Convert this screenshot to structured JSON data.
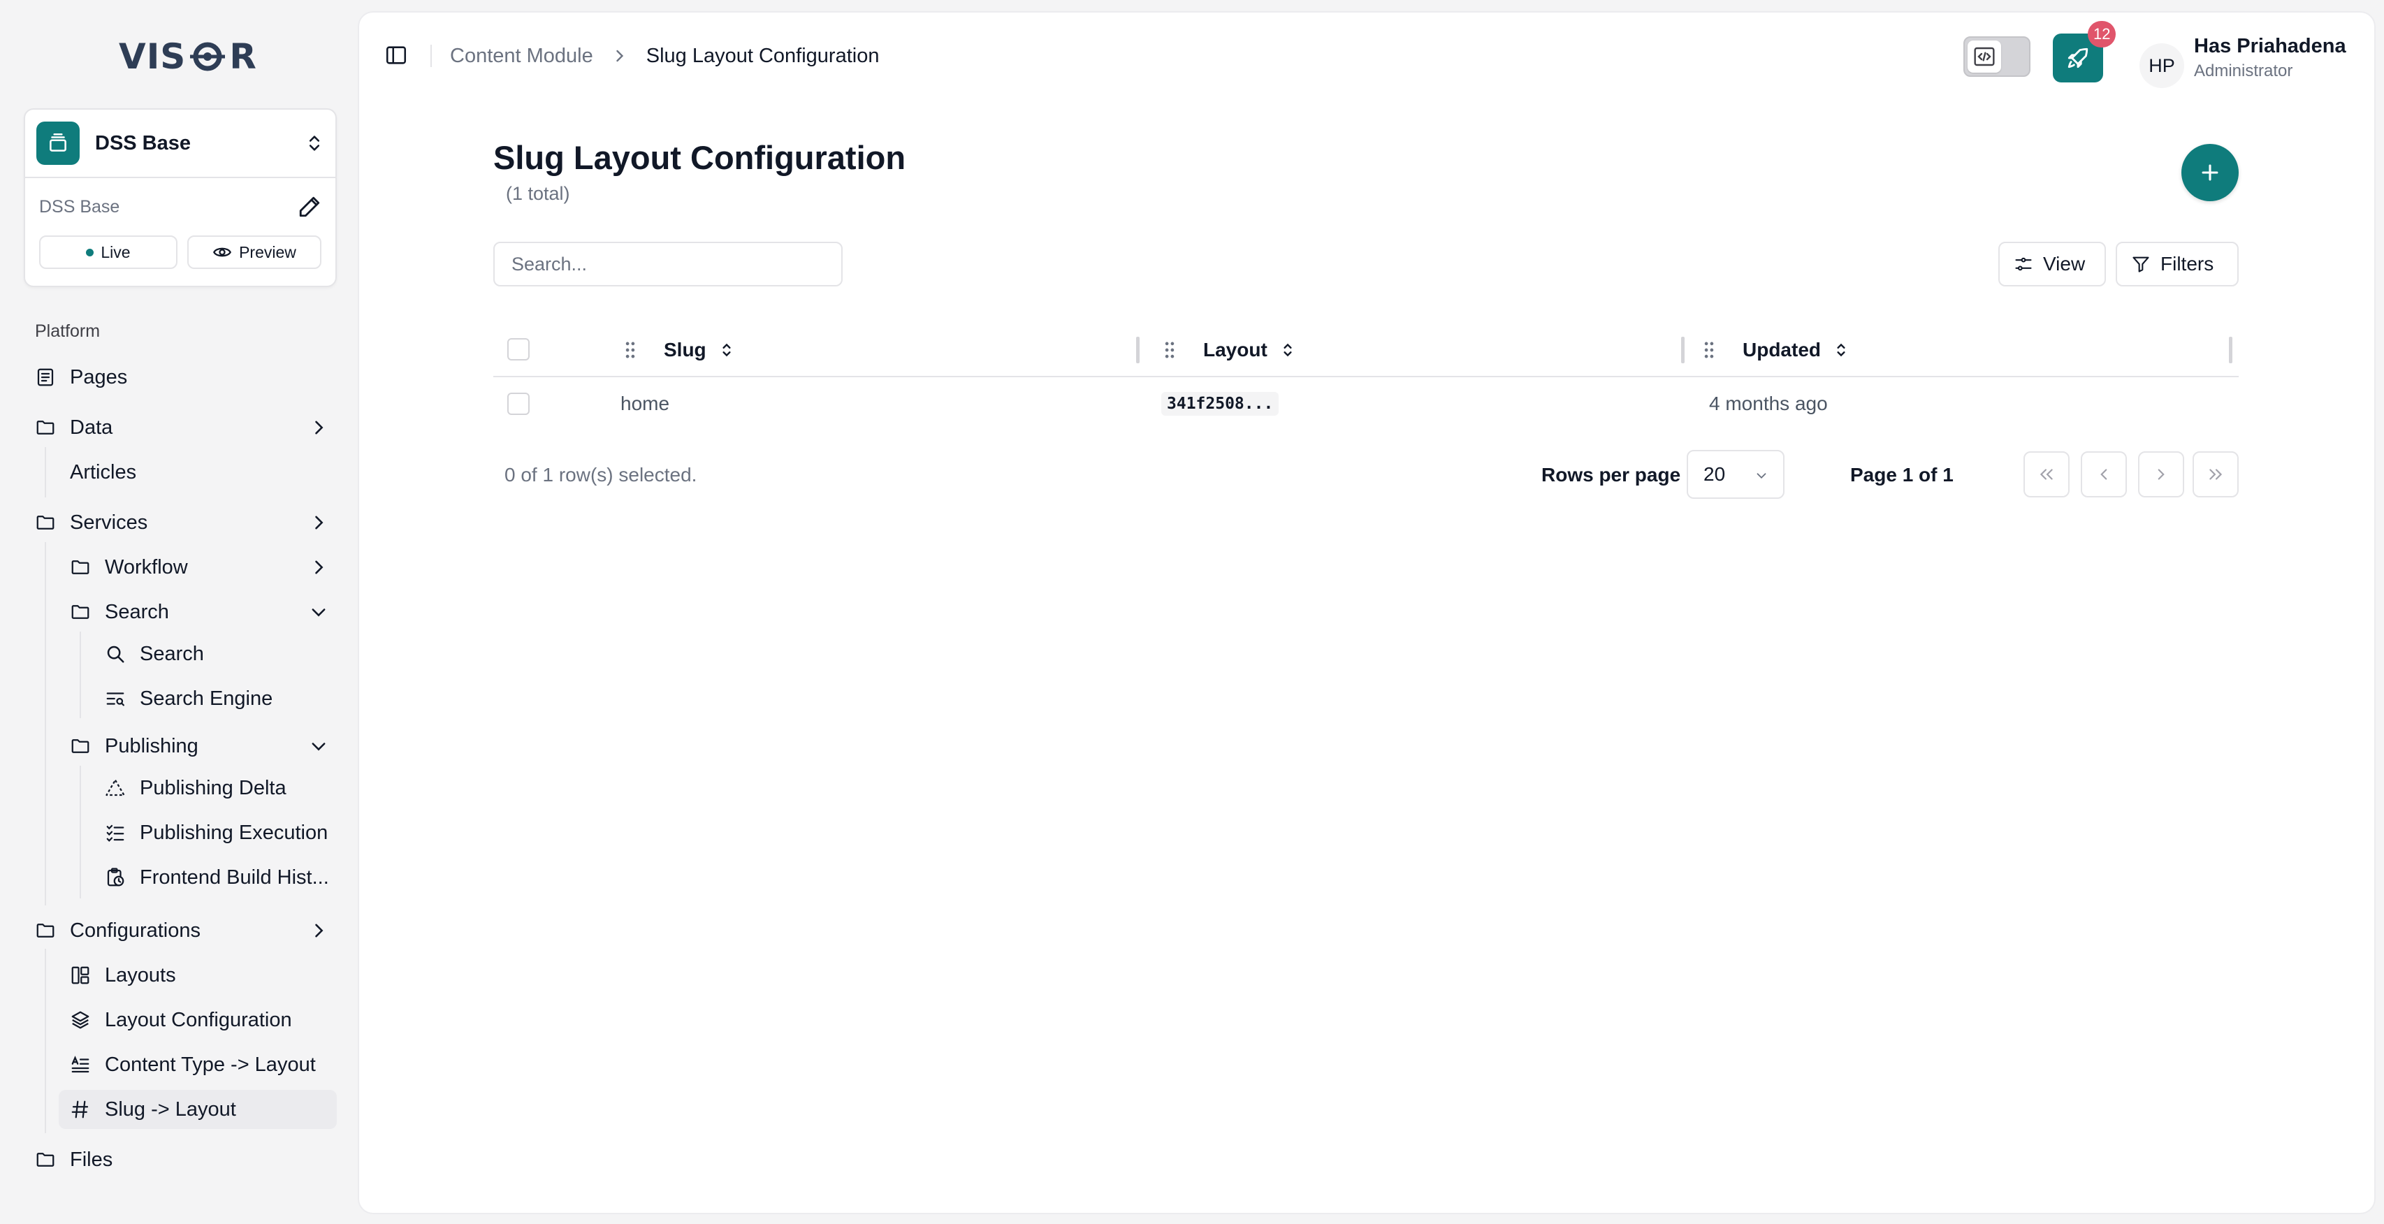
{
  "app": {
    "logo_text": "VISOR"
  },
  "project": {
    "name": "DSS Base",
    "sub_label": "DSS Base",
    "live_label": "Live",
    "preview_label": "Preview"
  },
  "sidebar": {
    "section_label": "Platform",
    "items": {
      "pages": "Pages",
      "data": "Data",
      "articles": "Articles",
      "services": "Services",
      "workflow": "Workflow",
      "search_folder": "Search",
      "search": "Search",
      "search_engine": "Search Engine",
      "publishing": "Publishing",
      "publishing_delta": "Publishing Delta",
      "publishing_execution": "Publishing Execution",
      "frontend_build": "Frontend Build Hist...",
      "configurations": "Configurations",
      "layouts": "Layouts",
      "layout_configuration": "Layout Configuration",
      "content_type_layout": "Content Type -> Layout",
      "slug_layout": "Slug -> Layout",
      "files": "Files"
    }
  },
  "header": {
    "breadcrumb_parent": "Content Module",
    "breadcrumb_current": "Slug Layout Configuration",
    "deploy_badge": "12",
    "user_initials": "HP",
    "user_name": "Has Priahadena",
    "user_role": "Administrator"
  },
  "page": {
    "title": "Slug Layout Configuration",
    "count": "(1 total)",
    "search_placeholder": "Search...",
    "view_label": "View",
    "filters_label": "Filters"
  },
  "table": {
    "columns": [
      "Slug",
      "Layout",
      "Updated"
    ],
    "rows": [
      {
        "slug": "home",
        "layout": "341f2508...",
        "updated": "4 months ago"
      }
    ],
    "selected_text": "0 of 1 row(s) selected.",
    "rows_per_page_label": "Rows per page",
    "rows_per_page_value": "20",
    "page_label": "Page 1 of 1"
  },
  "colors": {
    "accent": "#0f7c7c",
    "badge": "#e0556b"
  }
}
